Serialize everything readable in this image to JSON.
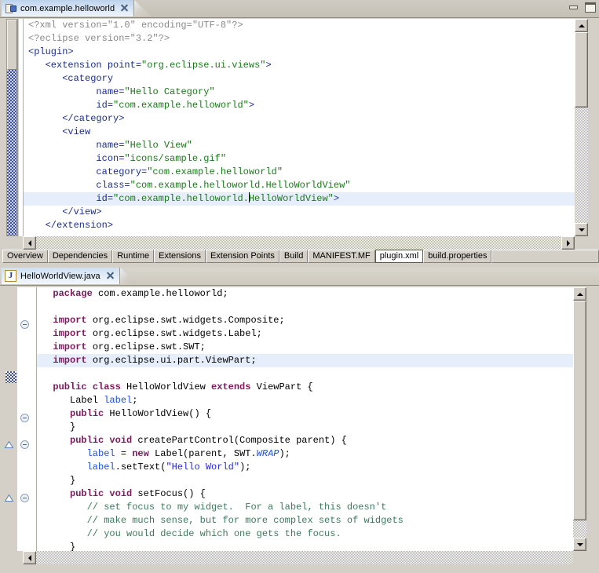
{
  "window": {
    "minimize_label": "Minimize",
    "maximize_label": "Maximize"
  },
  "editors": [
    {
      "tab": {
        "title": "com.example.helloworld",
        "icon": "plugin-manifest-icon",
        "close_label": "Close",
        "active": true
      },
      "file_type": "xml",
      "lines": [
        [
          {
            "t": "<?xml version=\"1.0\" encoding=\"UTF-8\"?>",
            "c": "s-pi"
          }
        ],
        [
          {
            "t": "<?eclipse version=\"3.2\"?>",
            "c": "s-pi"
          }
        ],
        [
          {
            "t": "<plugin>",
            "c": "s-tag"
          }
        ],
        [
          {
            "t": "   <extension ",
            "c": "s-tag"
          },
          {
            "t": "point=",
            "c": "s-attr"
          },
          {
            "t": "\"org.eclipse.ui.views\"",
            "c": "s-val"
          },
          {
            "t": ">",
            "c": "s-tag"
          }
        ],
        [
          {
            "t": "      <category",
            "c": "s-tag"
          }
        ],
        [
          {
            "t": "            ",
            "c": "s-txt"
          },
          {
            "t": "name=",
            "c": "s-attr"
          },
          {
            "t": "\"Hello Category\"",
            "c": "s-val"
          }
        ],
        [
          {
            "t": "            ",
            "c": "s-txt"
          },
          {
            "t": "id=",
            "c": "s-attr"
          },
          {
            "t": "\"com.example.helloworld\"",
            "c": "s-val"
          },
          {
            "t": ">",
            "c": "s-tag"
          }
        ],
        [
          {
            "t": "      </category>",
            "c": "s-tag"
          }
        ],
        [
          {
            "t": "      <view",
            "c": "s-tag"
          }
        ],
        [
          {
            "t": "            ",
            "c": "s-txt"
          },
          {
            "t": "name=",
            "c": "s-attr"
          },
          {
            "t": "\"Hello View\"",
            "c": "s-val"
          }
        ],
        [
          {
            "t": "            ",
            "c": "s-txt"
          },
          {
            "t": "icon=",
            "c": "s-attr"
          },
          {
            "t": "\"icons/sample.gif\"",
            "c": "s-val"
          }
        ],
        [
          {
            "t": "            ",
            "c": "s-txt"
          },
          {
            "t": "category=",
            "c": "s-attr"
          },
          {
            "t": "\"com.example.helloworld\"",
            "c": "s-val"
          }
        ],
        [
          {
            "t": "            ",
            "c": "s-txt"
          },
          {
            "t": "class=",
            "c": "s-attr"
          },
          {
            "t": "\"com.example.helloworld.HelloWorldView\"",
            "c": "s-val"
          }
        ],
        [
          {
            "t": "            ",
            "c": "s-txt"
          },
          {
            "t": "id=",
            "c": "s-attr"
          },
          {
            "t": "\"com.example.helloworld.",
            "c": "s-val"
          },
          {
            "t": "|CARET|",
            "c": "caret"
          },
          {
            "t": "HelloWorldView\"",
            "c": "s-val"
          },
          {
            "t": ">",
            "c": "s-tag"
          }
        ],
        [
          {
            "t": "      </view>",
            "c": "s-tag"
          }
        ],
        [
          {
            "t": "   </extension>",
            "c": "s-tag"
          }
        ]
      ],
      "highlighted_line_index": 13
    },
    {
      "tab": {
        "title": "HelloWorldView.java",
        "icon": "java-file-icon",
        "icon_glyph": "J",
        "close_label": "Close",
        "active": true
      },
      "file_type": "java",
      "lines": [
        [
          {
            "t": "  ",
            "c": "s-txt"
          },
          {
            "t": "package",
            "c": "s-kw"
          },
          {
            "t": " com.example.helloworld;",
            "c": "s-txt"
          }
        ],
        [
          {
            "t": "",
            "c": "s-txt"
          }
        ],
        [
          {
            "t": "  ",
            "c": "s-txt"
          },
          {
            "t": "import",
            "c": "s-kw"
          },
          {
            "t": " org.eclipse.swt.widgets.Composite;",
            "c": "s-txt"
          }
        ],
        [
          {
            "t": "  ",
            "c": "s-txt"
          },
          {
            "t": "import",
            "c": "s-kw"
          },
          {
            "t": " org.eclipse.swt.widgets.Label;",
            "c": "s-txt"
          }
        ],
        [
          {
            "t": "  ",
            "c": "s-txt"
          },
          {
            "t": "import",
            "c": "s-kw"
          },
          {
            "t": " org.eclipse.swt.SWT;",
            "c": "s-txt"
          }
        ],
        [
          {
            "t": "  ",
            "c": "s-txt"
          },
          {
            "t": "import",
            "c": "s-kw"
          },
          {
            "t": " org.eclipse.ui.part.ViewPart;",
            "c": "s-txt"
          }
        ],
        [
          {
            "t": "",
            "c": "s-txt"
          }
        ],
        [
          {
            "t": "  ",
            "c": "s-txt"
          },
          {
            "t": "public class",
            "c": "s-kw"
          },
          {
            "t": " HelloWorldView ",
            "c": "s-txt"
          },
          {
            "t": "extends",
            "c": "s-kw"
          },
          {
            "t": " ViewPart {",
            "c": "s-txt"
          }
        ],
        [
          {
            "t": "     Label ",
            "c": "s-txt"
          },
          {
            "t": "label",
            "c": "s-field"
          },
          {
            "t": ";",
            "c": "s-txt"
          }
        ],
        [
          {
            "t": "     ",
            "c": "s-txt"
          },
          {
            "t": "public",
            "c": "s-kw"
          },
          {
            "t": " HelloWorldView() {",
            "c": "s-txt"
          }
        ],
        [
          {
            "t": "     }",
            "c": "s-txt"
          }
        ],
        [
          {
            "t": "     ",
            "c": "s-txt"
          },
          {
            "t": "public void",
            "c": "s-kw"
          },
          {
            "t": " createPartControl(Composite parent) {",
            "c": "s-txt"
          }
        ],
        [
          {
            "t": "        ",
            "c": "s-txt"
          },
          {
            "t": "label",
            "c": "s-field"
          },
          {
            "t": " = ",
            "c": "s-txt"
          },
          {
            "t": "new",
            "c": "s-kw"
          },
          {
            "t": " Label(parent, SWT.",
            "c": "s-txt"
          },
          {
            "t": "WRAP",
            "c": "s-static"
          },
          {
            "t": ");",
            "c": "s-txt"
          }
        ],
        [
          {
            "t": "        ",
            "c": "s-txt"
          },
          {
            "t": "label",
            "c": "s-field"
          },
          {
            "t": ".setText(",
            "c": "s-txt"
          },
          {
            "t": "\"Hello World\"",
            "c": "s-str"
          },
          {
            "t": ");",
            "c": "s-txt"
          }
        ],
        [
          {
            "t": "     }",
            "c": "s-txt"
          }
        ],
        [
          {
            "t": "     ",
            "c": "s-txt"
          },
          {
            "t": "public void",
            "c": "s-kw"
          },
          {
            "t": " setFocus() {",
            "c": "s-txt"
          }
        ],
        [
          {
            "t": "        ",
            "c": "s-txt"
          },
          {
            "t": "// set focus to my widget.  For a label, this doesn't",
            "c": "s-cmt"
          }
        ],
        [
          {
            "t": "        ",
            "c": "s-txt"
          },
          {
            "t": "// make much sense, but for more complex sets of widgets",
            "c": "s-cmt"
          }
        ],
        [
          {
            "t": "        ",
            "c": "s-txt"
          },
          {
            "t": "// you would decide which one gets the focus.",
            "c": "s-cmt"
          }
        ],
        [
          {
            "t": "     }",
            "c": "s-txt"
          }
        ]
      ],
      "highlighted_line_index": 5
    }
  ],
  "form_tabs": {
    "items": [
      {
        "label": "Overview",
        "selected": false
      },
      {
        "label": "Dependencies",
        "selected": false
      },
      {
        "label": "Runtime",
        "selected": false
      },
      {
        "label": "Extensions",
        "selected": false
      },
      {
        "label": "Extension Points",
        "selected": false
      },
      {
        "label": "Build",
        "selected": false
      },
      {
        "label": "MANIFEST.MF",
        "selected": false
      },
      {
        "label": "plugin.xml",
        "selected": true
      },
      {
        "label": "build.properties",
        "selected": false
      }
    ]
  },
  "colors": {
    "chrome": "#d4d0c8",
    "editor_background": "#ffffff",
    "current_line_highlight": "#e5eefa",
    "xml_tag": "#1b2f8a",
    "xml_value": "#1a7a1a",
    "java_keyword": "#7b1a5c",
    "java_string": "#2727d8",
    "java_comment": "#3c7a5e",
    "java_field": "#1f4fd8"
  }
}
